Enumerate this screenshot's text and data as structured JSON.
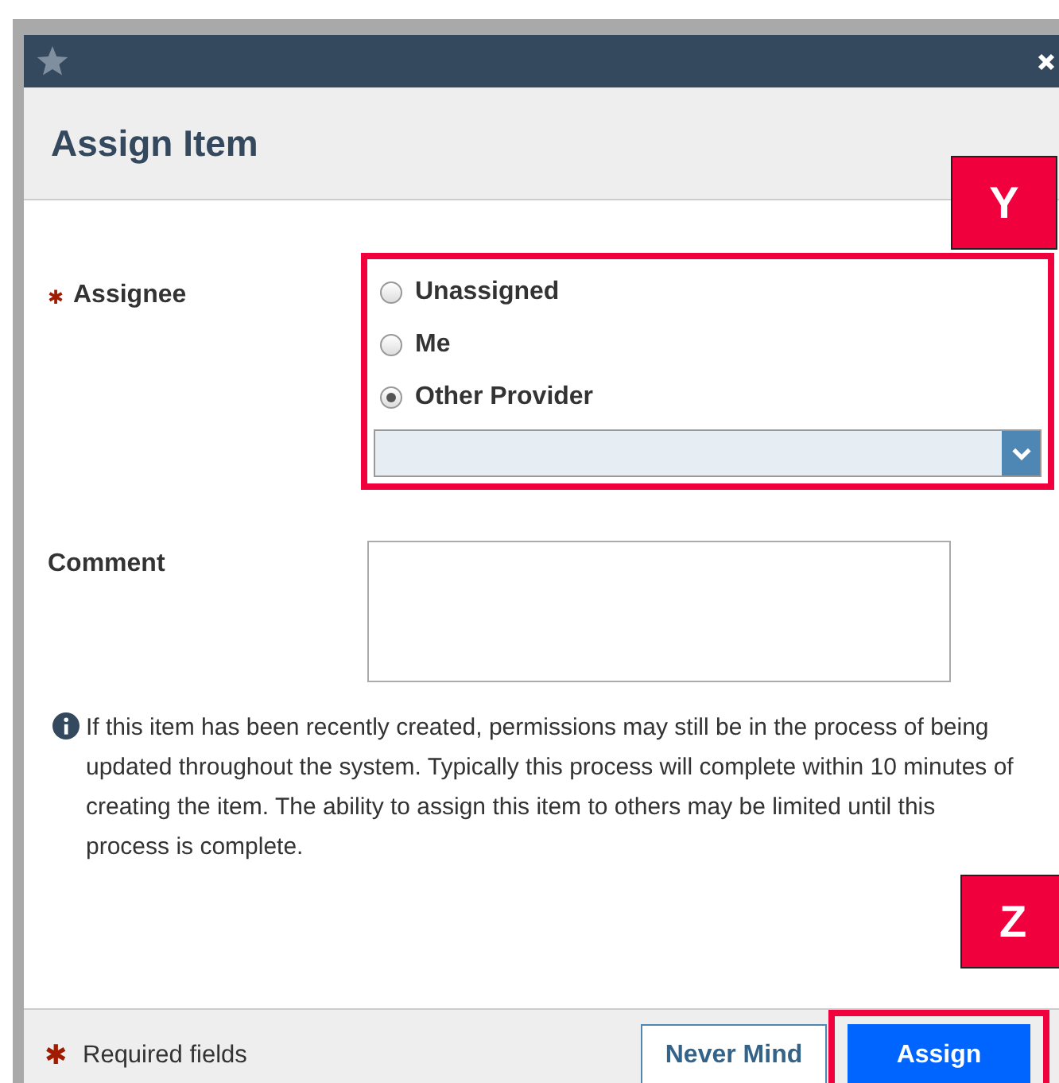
{
  "dialog": {
    "title": "Assign Item"
  },
  "assignee": {
    "label": "Assignee",
    "required": true,
    "required_mark": "✱",
    "options": [
      {
        "label": "Unassigned",
        "selected": false
      },
      {
        "label": "Me",
        "selected": false
      },
      {
        "label": "Other Provider",
        "selected": true
      }
    ]
  },
  "comment": {
    "label": "Comment"
  },
  "info": "If this item has been recently created, permissions may still be in the process of being updated throughout the system. Typically this process will complete within 10 minutes of creating the item. The ability to assign this item to others may be limited until this process is complete.",
  "footer": {
    "required_mark": "✱",
    "required_note": "Required fields",
    "buttons": [
      {
        "label": "Never Mind",
        "kind": "secondary"
      },
      {
        "label": "Assign",
        "kind": "primary"
      }
    ]
  },
  "callouts": [
    {
      "label": "Y"
    },
    {
      "label": "Z"
    }
  ]
}
